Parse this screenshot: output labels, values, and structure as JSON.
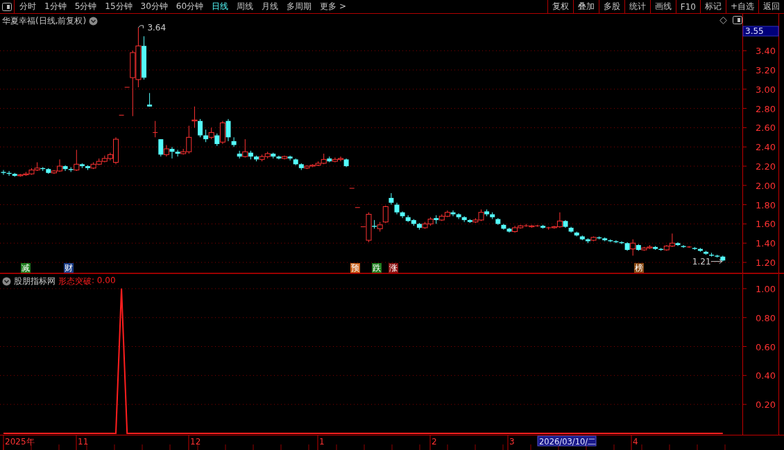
{
  "toolbar": {
    "periods": [
      {
        "label": "分时",
        "selected": false
      },
      {
        "label": "1分钟",
        "selected": false
      },
      {
        "label": "5分钟",
        "selected": false
      },
      {
        "label": "15分钟",
        "selected": false
      },
      {
        "label": "30分钟",
        "selected": false
      },
      {
        "label": "60分钟",
        "selected": false
      },
      {
        "label": "日线",
        "selected": true
      },
      {
        "label": "周线",
        "selected": false
      },
      {
        "label": "月线",
        "selected": false
      },
      {
        "label": "多周期",
        "selected": false
      }
    ],
    "more": "更多 >",
    "actions": [
      "复权",
      "叠加",
      "多股",
      "统计",
      "画线",
      "F10",
      "标记",
      "+自选",
      "返回"
    ]
  },
  "main_chart": {
    "title": "华夏幸福(日线,前复权)",
    "price_tag": "3.55",
    "chart_data": {
      "type": "candlestick",
      "grid": true,
      "ylim": [
        1.085,
        3.783
      ],
      "yticks": [
        {
          "value": 1.2,
          "label": "1.20"
        },
        {
          "value": 1.4,
          "label": "1.40"
        },
        {
          "value": 1.6,
          "label": "1.60"
        },
        {
          "value": 1.8,
          "label": "1.80"
        },
        {
          "value": 2.0,
          "label": "2.00"
        },
        {
          "value": 2.2,
          "label": "2.20"
        },
        {
          "value": 2.4,
          "label": "2.40"
        },
        {
          "value": 2.6,
          "label": "2.60"
        },
        {
          "value": 2.8,
          "label": "2.80"
        },
        {
          "value": 3.0,
          "label": "3.00"
        },
        {
          "value": 3.2,
          "label": "3.20"
        },
        {
          "value": 3.4,
          "label": "3.40"
        }
      ],
      "ohlc": [
        [
          2.14,
          2.16,
          2.11,
          2.13
        ],
        [
          2.13,
          2.15,
          2.1,
          2.12
        ],
        [
          2.12,
          2.13,
          2.09,
          2.1
        ],
        [
          2.1,
          2.12,
          2.09,
          2.11
        ],
        [
          2.11,
          2.14,
          2.1,
          2.12
        ],
        [
          2.12,
          2.18,
          2.11,
          2.16
        ],
        [
          2.16,
          2.24,
          2.15,
          2.18
        ],
        [
          2.18,
          2.19,
          2.15,
          2.17
        ],
        [
          2.17,
          2.18,
          2.12,
          2.13
        ],
        [
          2.13,
          2.16,
          2.12,
          2.15
        ],
        [
          2.15,
          2.27,
          2.14,
          2.2
        ],
        [
          2.2,
          2.21,
          2.15,
          2.17
        ],
        [
          2.17,
          2.19,
          2.14,
          2.16
        ],
        [
          2.16,
          2.37,
          2.15,
          2.22
        ],
        [
          2.22,
          2.23,
          2.18,
          2.2
        ],
        [
          2.2,
          2.21,
          2.16,
          2.18
        ],
        [
          2.18,
          2.24,
          2.17,
          2.22
        ],
        [
          2.22,
          2.28,
          2.21,
          2.25
        ],
        [
          2.25,
          2.31,
          2.24,
          2.28
        ],
        [
          2.28,
          2.34,
          2.26,
          2.32
        ],
        [
          2.24,
          2.5,
          2.22,
          2.48
        ],
        [
          2.73,
          2.73,
          2.73,
          2.73
        ],
        [
          3.02,
          3.02,
          3.02,
          3.02
        ],
        [
          3.12,
          3.4,
          2.72,
          3.38
        ],
        [
          3.1,
          3.64,
          3.02,
          3.45
        ],
        [
          3.45,
          3.55,
          3.1,
          3.12
        ],
        [
          2.84,
          2.96,
          2.82,
          2.82
        ],
        [
          2.55,
          2.67,
          2.5,
          2.55
        ],
        [
          2.48,
          2.48,
          2.3,
          2.32
        ],
        [
          2.32,
          2.42,
          2.3,
          2.38
        ],
        [
          2.38,
          2.4,
          2.28,
          2.35
        ],
        [
          2.35,
          2.37,
          2.3,
          2.33
        ],
        [
          2.33,
          2.38,
          2.32,
          2.35
        ],
        [
          2.35,
          2.62,
          2.33,
          2.5
        ],
        [
          2.67,
          2.82,
          2.6,
          2.68
        ],
        [
          2.67,
          2.69,
          2.5,
          2.52
        ],
        [
          2.52,
          2.58,
          2.45,
          2.48
        ],
        [
          2.5,
          2.6,
          2.48,
          2.55
        ],
        [
          2.52,
          2.54,
          2.41,
          2.43
        ],
        [
          2.45,
          2.67,
          2.43,
          2.65
        ],
        [
          2.67,
          2.69,
          2.46,
          2.5
        ],
        [
          2.46,
          2.5,
          2.4,
          2.42
        ],
        [
          2.33,
          2.36,
          2.28,
          2.3
        ],
        [
          2.3,
          2.48,
          2.29,
          2.35
        ],
        [
          2.34,
          2.36,
          2.27,
          2.3
        ],
        [
          2.3,
          2.31,
          2.25,
          2.27
        ],
        [
          2.27,
          2.32,
          2.25,
          2.3
        ],
        [
          2.3,
          2.35,
          2.28,
          2.33
        ],
        [
          2.33,
          2.34,
          2.28,
          2.3
        ],
        [
          2.3,
          2.31,
          2.27,
          2.28
        ],
        [
          2.28,
          2.31,
          2.27,
          2.3
        ],
        [
          2.3,
          2.31,
          2.26,
          2.28
        ],
        [
          2.27,
          2.28,
          2.21,
          2.22
        ],
        [
          2.22,
          2.23,
          2.16,
          2.18
        ],
        [
          2.18,
          2.21,
          2.17,
          2.2
        ],
        [
          2.2,
          2.22,
          2.19,
          2.21
        ],
        [
          2.21,
          2.25,
          2.2,
          2.23
        ],
        [
          2.23,
          2.33,
          2.22,
          2.27
        ],
        [
          2.28,
          2.3,
          2.24,
          2.25
        ],
        [
          2.25,
          2.29,
          2.24,
          2.27
        ],
        [
          2.27,
          2.3,
          2.25,
          2.28
        ],
        [
          2.27,
          2.28,
          2.19,
          2.2
        ],
        [
          1.97,
          1.97,
          1.97,
          1.97
        ],
        [
          1.77,
          1.77,
          1.77,
          1.77
        ],
        [
          1.57,
          1.57,
          1.57,
          1.57
        ],
        [
          1.43,
          1.72,
          1.41,
          1.7
        ],
        [
          1.58,
          1.64,
          1.55,
          1.57
        ],
        [
          1.55,
          1.62,
          1.52,
          1.59
        ],
        [
          1.62,
          1.79,
          1.61,
          1.78
        ],
        [
          1.87,
          1.92,
          1.8,
          1.82
        ],
        [
          1.8,
          1.82,
          1.7,
          1.72
        ],
        [
          1.72,
          1.73,
          1.66,
          1.68
        ],
        [
          1.67,
          1.69,
          1.62,
          1.63
        ],
        [
          1.64,
          1.65,
          1.58,
          1.6
        ],
        [
          1.6,
          1.61,
          1.54,
          1.56
        ],
        [
          1.56,
          1.62,
          1.55,
          1.6
        ],
        [
          1.6,
          1.67,
          1.58,
          1.65
        ],
        [
          1.66,
          1.69,
          1.6,
          1.64
        ],
        [
          1.64,
          1.7,
          1.63,
          1.68
        ],
        [
          1.68,
          1.74,
          1.67,
          1.72
        ],
        [
          1.72,
          1.74,
          1.68,
          1.7
        ],
        [
          1.7,
          1.71,
          1.65,
          1.67
        ],
        [
          1.67,
          1.68,
          1.62,
          1.64
        ],
        [
          1.64,
          1.65,
          1.61,
          1.62
        ],
        [
          1.62,
          1.66,
          1.61,
          1.64
        ],
        [
          1.64,
          1.75,
          1.63,
          1.72
        ],
        [
          1.73,
          1.75,
          1.68,
          1.7
        ],
        [
          1.7,
          1.72,
          1.65,
          1.67
        ],
        [
          1.65,
          1.66,
          1.59,
          1.6
        ],
        [
          1.59,
          1.6,
          1.54,
          1.55
        ],
        [
          1.55,
          1.56,
          1.51,
          1.52
        ],
        [
          1.52,
          1.58,
          1.51,
          1.56
        ],
        [
          1.56,
          1.59,
          1.55,
          1.58
        ],
        [
          1.58,
          1.6,
          1.57,
          1.58
        ],
        [
          1.57,
          1.59,
          1.56,
          1.58
        ],
        [
          1.58,
          1.59,
          1.57,
          1.58
        ],
        [
          1.58,
          1.59,
          1.55,
          1.56
        ],
        [
          1.56,
          1.57,
          1.54,
          1.56
        ],
        [
          1.56,
          1.58,
          1.55,
          1.57
        ],
        [
          1.57,
          1.72,
          1.56,
          1.63
        ],
        [
          1.63,
          1.64,
          1.56,
          1.57
        ],
        [
          1.56,
          1.57,
          1.51,
          1.52
        ],
        [
          1.51,
          1.52,
          1.47,
          1.48
        ],
        [
          1.47,
          1.48,
          1.43,
          1.44
        ],
        [
          1.44,
          1.45,
          1.4,
          1.42
        ],
        [
          1.43,
          1.47,
          1.42,
          1.46
        ],
        [
          1.46,
          1.47,
          1.44,
          1.45
        ],
        [
          1.45,
          1.46,
          1.42,
          1.43
        ],
        [
          1.43,
          1.44,
          1.41,
          1.42
        ],
        [
          1.42,
          1.43,
          1.4,
          1.41
        ],
        [
          1.41,
          1.42,
          1.39,
          1.4
        ],
        [
          1.4,
          1.41,
          1.32,
          1.33
        ],
        [
          1.34,
          1.44,
          1.27,
          1.4
        ],
        [
          1.38,
          1.39,
          1.32,
          1.33
        ],
        [
          1.33,
          1.36,
          1.32,
          1.35
        ],
        [
          1.35,
          1.38,
          1.34,
          1.36
        ],
        [
          1.36,
          1.37,
          1.33,
          1.34
        ],
        [
          1.34,
          1.35,
          1.32,
          1.33
        ],
        [
          1.33,
          1.38,
          1.32,
          1.37
        ],
        [
          1.37,
          1.5,
          1.36,
          1.4
        ],
        [
          1.4,
          1.41,
          1.37,
          1.38
        ],
        [
          1.37,
          1.38,
          1.35,
          1.36
        ],
        [
          1.36,
          1.37,
          1.35,
          1.36
        ],
        [
          1.35,
          1.36,
          1.33,
          1.34
        ],
        [
          1.34,
          1.35,
          1.31,
          1.32
        ],
        [
          1.31,
          1.32,
          1.28,
          1.29
        ],
        [
          1.28,
          1.3,
          1.26,
          1.27
        ],
        [
          1.27,
          1.28,
          1.25,
          1.26
        ],
        [
          1.26,
          1.27,
          1.21,
          1.22
        ]
      ],
      "annotations": [
        "3.64",
        "1.21"
      ]
    },
    "event_tags": [
      {
        "text": "减",
        "color": "#1e7d1e"
      },
      {
        "text": "财",
        "color": "#1c3f8a"
      },
      {
        "text": "预",
        "color": "#c8601a"
      },
      {
        "text": "跌",
        "color": "#1e7d1e"
      },
      {
        "text": "涨",
        "color": "#8a1414"
      },
      {
        "text": "榜",
        "color": "#8a4a14"
      }
    ]
  },
  "indicator": {
    "title": "股朋指标网",
    "reading": ": 0.00",
    "chart_data": {
      "type": "line",
      "grid": true,
      "ylim": [
        -0.01,
        1.105
      ],
      "yticks": [
        {
          "value": 0.2,
          "label": "0.20"
        },
        {
          "value": 0.4,
          "label": "0.40"
        },
        {
          "value": 0.6,
          "label": "0.60"
        },
        {
          "value": 0.8,
          "label": "0.80"
        },
        {
          "value": 1.0,
          "label": "1.00"
        }
      ],
      "series": [
        {
          "name": "形态突破",
          "color": "#ff1e1e",
          "values": [
            0,
            0,
            0,
            0,
            0,
            0,
            0,
            0,
            0,
            0,
            0,
            0,
            0,
            0,
            0,
            0,
            0,
            0,
            0,
            0,
            0,
            1,
            0,
            0,
            0,
            0,
            0,
            0,
            0,
            0,
            0,
            0,
            0,
            0,
            0,
            0,
            0,
            0,
            0,
            0,
            0,
            0,
            0,
            0,
            0,
            0,
            0,
            0,
            0,
            0,
            0,
            0,
            0,
            0,
            0,
            0,
            0,
            0,
            0,
            0,
            0,
            0,
            0,
            0,
            0,
            0,
            0,
            0,
            0,
            0,
            0,
            0,
            0,
            0,
            0,
            0,
            0,
            0,
            0,
            0,
            0,
            0,
            0,
            0,
            0,
            0,
            0,
            0,
            0,
            0,
            0,
            0,
            0,
            0,
            0,
            0,
            0,
            0,
            0,
            0,
            0,
            0,
            0,
            0,
            0,
            0,
            0,
            0,
            0,
            0,
            0,
            0,
            0,
            0,
            0,
            0,
            0,
            0,
            0,
            0,
            0,
            0,
            0,
            0,
            0,
            0,
            0,
            0,
            0
          ]
        }
      ]
    },
    "time_axis": {
      "labels": [
        "2025年",
        "11",
        "12",
        "1",
        "2",
        "3",
        "4"
      ],
      "cursor": "2026/03/10/二"
    }
  }
}
